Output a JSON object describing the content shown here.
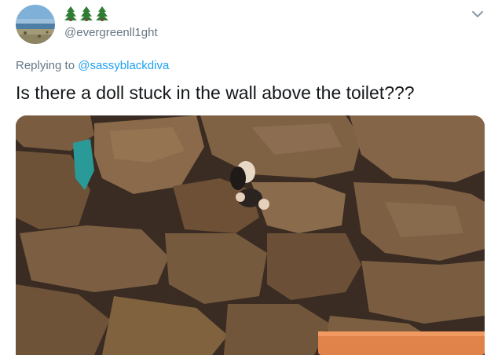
{
  "tweet": {
    "display_emojis": "🌲🌲🌲",
    "handle": "@evergreenll1ght",
    "replying_prefix": "Replying to ",
    "replying_to": "@sassyblackdiva",
    "text": "Is there a doll stuck in the wall above the toilet???"
  },
  "icons": {
    "avatar": "avatar-beach-landscape",
    "menu": "chevron-down-icon",
    "emoji": "evergreen-tree"
  },
  "colors": {
    "text": "#14171a",
    "secondary": "#657786",
    "link": "#1da1f2"
  }
}
